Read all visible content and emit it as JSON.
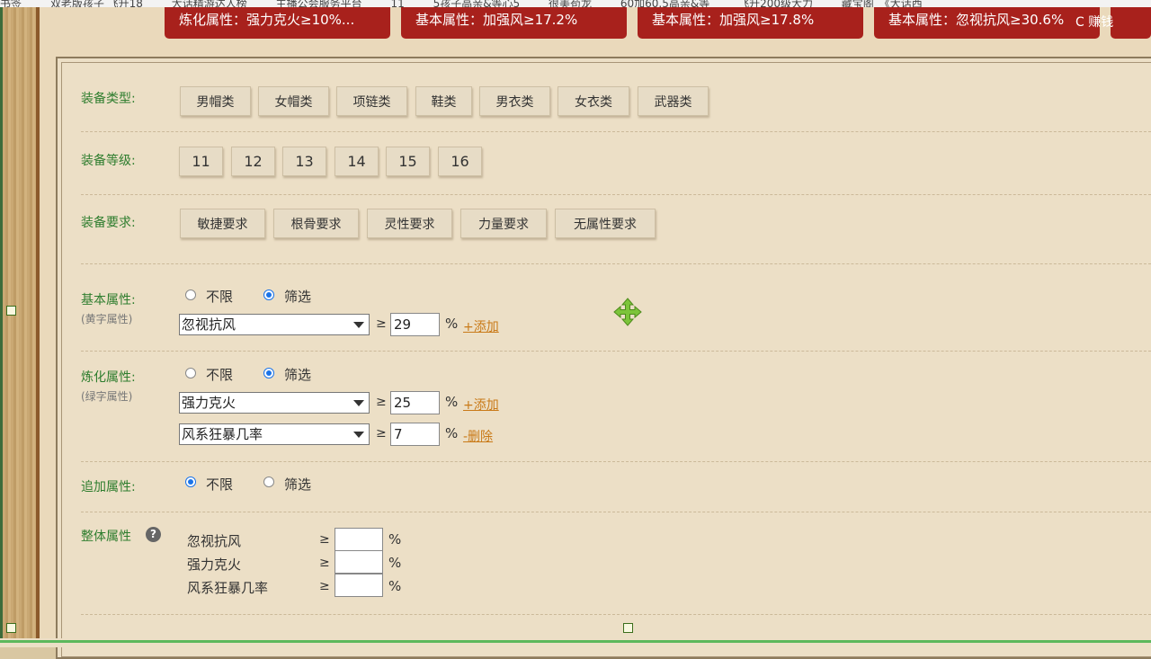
{
  "bookmarks": [
    "书签",
    "双老版孩子 飞升18",
    "大话精游达人榜",
    "主播公会服务平台",
    "11",
    "5孩子高亲&等心5",
    "很美苟龙",
    "60加60.5高亲&等",
    "飞升200级大力",
    "藏宝阁_《大话西"
  ],
  "tab_cards": [
    "炼化属性：强力克火≥10%...",
    "基本属性：加强风≥17.2%",
    "基本属性：加强风≥17.8%",
    "基本属性：忽视抗风≥30.6%"
  ],
  "tab_cards_extra": "C 赚钱",
  "equip_type": {
    "label": "装备类型:",
    "options": [
      "男帽类",
      "女帽类",
      "项链类",
      "鞋类",
      "男衣类",
      "女衣类",
      "武器类"
    ]
  },
  "equip_level": {
    "label": "装备等级:",
    "options": [
      "11",
      "12",
      "13",
      "14",
      "15",
      "16"
    ]
  },
  "equip_req": {
    "label": "装备要求:",
    "options": [
      "敏捷要求",
      "根骨要求",
      "灵性要求",
      "力量要求",
      "无属性要求"
    ]
  },
  "basic_attr": {
    "label": "基本属性:",
    "sublabel": "(黄字属性)",
    "opt_unlimited": "不限",
    "opt_filter": "筛选",
    "selected": "筛选",
    "rows": [
      {
        "attr": "忽视抗风",
        "ge": "≥",
        "value": "29",
        "unit": "%",
        "action": "+添加"
      }
    ]
  },
  "refine_attr": {
    "label": "炼化属性:",
    "sublabel": "(绿字属性)",
    "opt_unlimited": "不限",
    "opt_filter": "筛选",
    "selected": "筛选",
    "rows": [
      {
        "attr": "强力克火",
        "ge": "≥",
        "value": "25",
        "unit": "%",
        "action": "+添加"
      },
      {
        "attr": "风系狂暴几率",
        "ge": "≥",
        "value": "7",
        "unit": "%",
        "action": "-删除"
      }
    ]
  },
  "extra_attr": {
    "label": "追加属性:",
    "opt_unlimited": "不限",
    "opt_filter": "筛选",
    "selected": "不限"
  },
  "overall_attr": {
    "label": "整体属性",
    "help": "?",
    "rows": [
      {
        "name": "忽视抗风",
        "ge": "≥",
        "value": "",
        "unit": "%"
      },
      {
        "name": "强力克火",
        "ge": "≥",
        "value": "",
        "unit": "%"
      },
      {
        "name": "风系狂暴几率",
        "ge": "≥",
        "value": "",
        "unit": "%"
      }
    ]
  },
  "colors": {
    "accent_red": "#a8211c",
    "label_green": "#2e7d2e",
    "link_orange": "#c97a18",
    "radio_blue": "#1a73e8"
  },
  "icons": {
    "move": "move-cross-icon",
    "help": "help-circle-icon"
  }
}
